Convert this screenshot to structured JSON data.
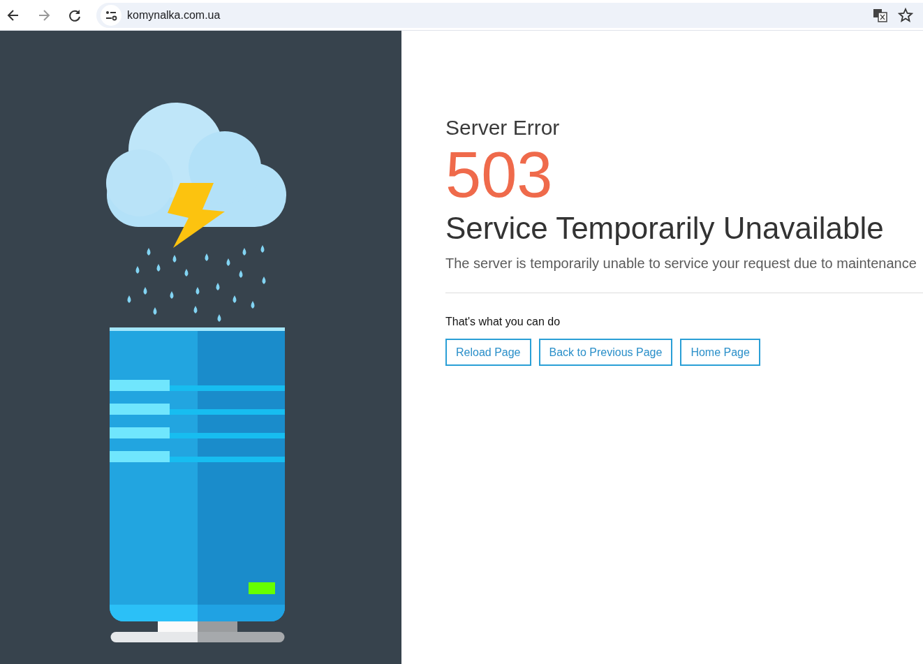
{
  "browser": {
    "url": "komynalka.com.ua"
  },
  "error": {
    "heading": "Server Error",
    "code": "503",
    "title": "Service Temporarily Unavailable",
    "description": "The server is temporarily unable to service your request due to maintenance"
  },
  "actions": {
    "label": "That's what you can do",
    "buttons": [
      "Reload Page",
      "Back to Previous Page",
      "Home Page"
    ]
  }
}
